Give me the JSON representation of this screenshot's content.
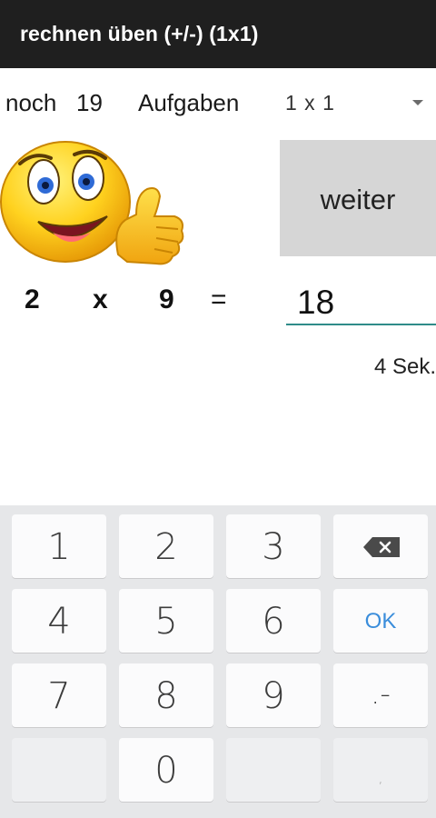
{
  "app": {
    "title": "rechnen üben (+/-) (1x1)"
  },
  "status": {
    "noch_label": "noch",
    "remaining": "19",
    "tasks_label": "Aufgaben"
  },
  "mode_select": {
    "value": "1 x 1"
  },
  "next_button": {
    "label": "weiter"
  },
  "equation": {
    "operand_a": "2",
    "operator": "x",
    "operand_b": "9",
    "equals": "=",
    "answer": "18"
  },
  "timer": {
    "text": "4 Sek."
  },
  "keyboard": {
    "rows": [
      [
        "1",
        "2",
        "3",
        "⌫"
      ],
      [
        "4",
        "5",
        "6",
        "OK"
      ],
      [
        "7",
        "8",
        "9",
        ".-"
      ],
      [
        "",
        "0",
        "",
        ","
      ]
    ],
    "accent_color": "#3a8ddb"
  },
  "icons": {
    "emoji": "thumbs-up-smiley-icon",
    "backspace": "backspace-icon",
    "dropdown": "chevron-down-icon"
  }
}
